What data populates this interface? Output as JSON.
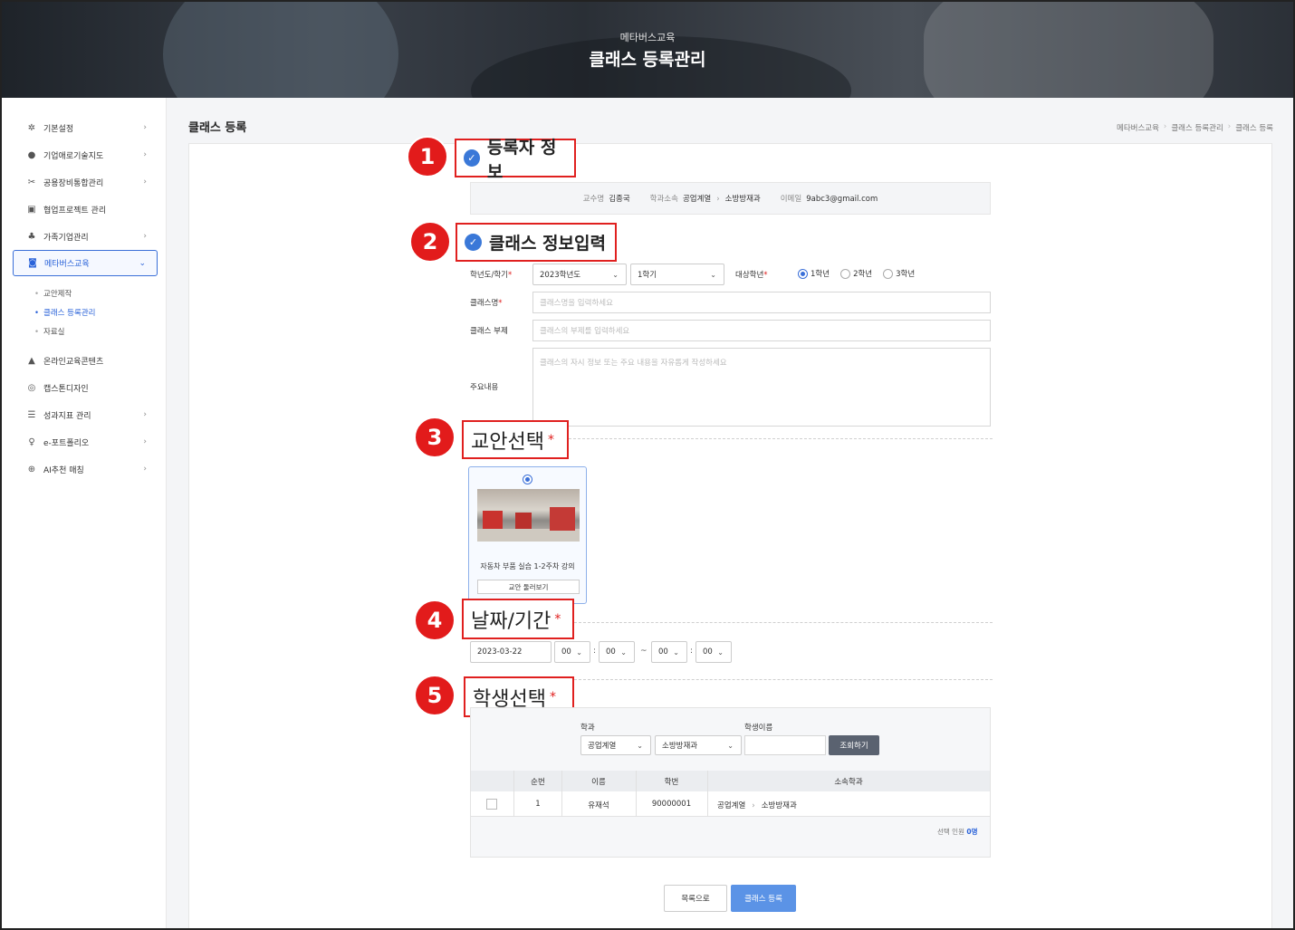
{
  "banner": {
    "subtitle": "메타버스교육",
    "title": "클래스 등록관리"
  },
  "sidebar": {
    "items": [
      {
        "label": "기본설정",
        "icon": "gear-icon",
        "glyph": "✲",
        "chevron": "›"
      },
      {
        "label": "기업애로기술지도",
        "icon": "question-icon",
        "glyph": "●",
        "chevron": "›"
      },
      {
        "label": "공용장비통합관리",
        "icon": "tools-icon",
        "glyph": "✂",
        "chevron": "›"
      },
      {
        "label": "협업프로젝트 관리",
        "icon": "project-icon",
        "glyph": "▣",
        "chevron": ""
      },
      {
        "label": "가족기업관리",
        "icon": "org-chart-icon",
        "glyph": "♣",
        "chevron": "›"
      },
      {
        "label": "메타버스교육",
        "icon": "vr-goggles-icon",
        "glyph": "◙",
        "chevron": "⌄"
      },
      {
        "label": "온라인교육콘텐츠",
        "icon": "online-content-icon",
        "glyph": "▲",
        "chevron": ""
      },
      {
        "label": "캡스톤디자인",
        "icon": "palette-icon",
        "glyph": "◎",
        "chevron": ""
      },
      {
        "label": "성과지표 관리",
        "icon": "list-icon",
        "glyph": "☰",
        "chevron": "›"
      },
      {
        "label": "e-포트폴리오",
        "icon": "award-icon",
        "glyph": "♀",
        "chevron": "›"
      },
      {
        "label": "AI추천 매칭",
        "icon": "target-icon",
        "glyph": "⊕",
        "chevron": "›"
      }
    ],
    "sub_items": [
      "교안제작",
      "클래스 등록관리",
      "자료실"
    ]
  },
  "page": {
    "title": "클래스 등록",
    "breadcrumbs": [
      "메타버스교육",
      "클래스 등록관리",
      "클래스 등록"
    ]
  },
  "callouts": {
    "one": "1",
    "two": "2",
    "three": "3",
    "four": "4",
    "five": "5",
    "registrant": "등록자 정보",
    "class_info": "클래스 정보입력",
    "lesson": "교안선택",
    "period": "날짜/기간",
    "students": "학생선택",
    "required_mark": "*",
    "check": "✓"
  },
  "registrant": {
    "professor_label": "교수명",
    "professor": "김종국",
    "dept_label": "학과소속",
    "college": "공업계열",
    "arrow": "›",
    "dept": "소방방재과",
    "email_label": "이메일",
    "email": "9abc3@gmail.com"
  },
  "form": {
    "year_label": "학년도/학기",
    "year_value": "2023학년도",
    "semester_value": "1학기",
    "grade_label": "대상학년",
    "grades": [
      "1학년",
      "2학년",
      "3학년"
    ],
    "selected_grade": "1학년",
    "name_label": "클래스명",
    "name_placeholder": "클래스명을 입력하세요",
    "subtitle_label": "클래스 부제",
    "subtitle_placeholder": "클래스의 부제를 입력하세요",
    "content_label": "주요내용",
    "content_placeholder": "클래스의 자시 정보 또는 주요 내용을 자유롭게 작성하세요",
    "required_mark": "*",
    "caret": "⌄"
  },
  "lesson": {
    "title": "자동차 부품 실습 1-2주차 강의",
    "preview_label": "교안 둘러보기"
  },
  "period": {
    "date": "2023-03-22",
    "start_hour": "00",
    "start_min": "00",
    "end_hour": "00",
    "end_min": "00",
    "colon": ":",
    "tilde": "~"
  },
  "students": {
    "dept_label": "학과",
    "name_label": "학생이름",
    "college_select": "공업계열",
    "dept_select": "소방방재과",
    "search_button": "조회하기",
    "columns": [
      "순번",
      "이름",
      "학번",
      "소속학과"
    ],
    "rows": [
      {
        "no": "1",
        "name": "유재석",
        "id": "90000001",
        "college": "공업계열",
        "dept": "소방방재과"
      }
    ],
    "selected_label": "선택 인원",
    "selected_count": "0명"
  },
  "actions": {
    "back": "목록으로",
    "register": "클래스 등록"
  },
  "colors": {
    "accent": "#2b63d9",
    "callout_red": "#e21b1b",
    "primary_button": "#5b93e6"
  }
}
